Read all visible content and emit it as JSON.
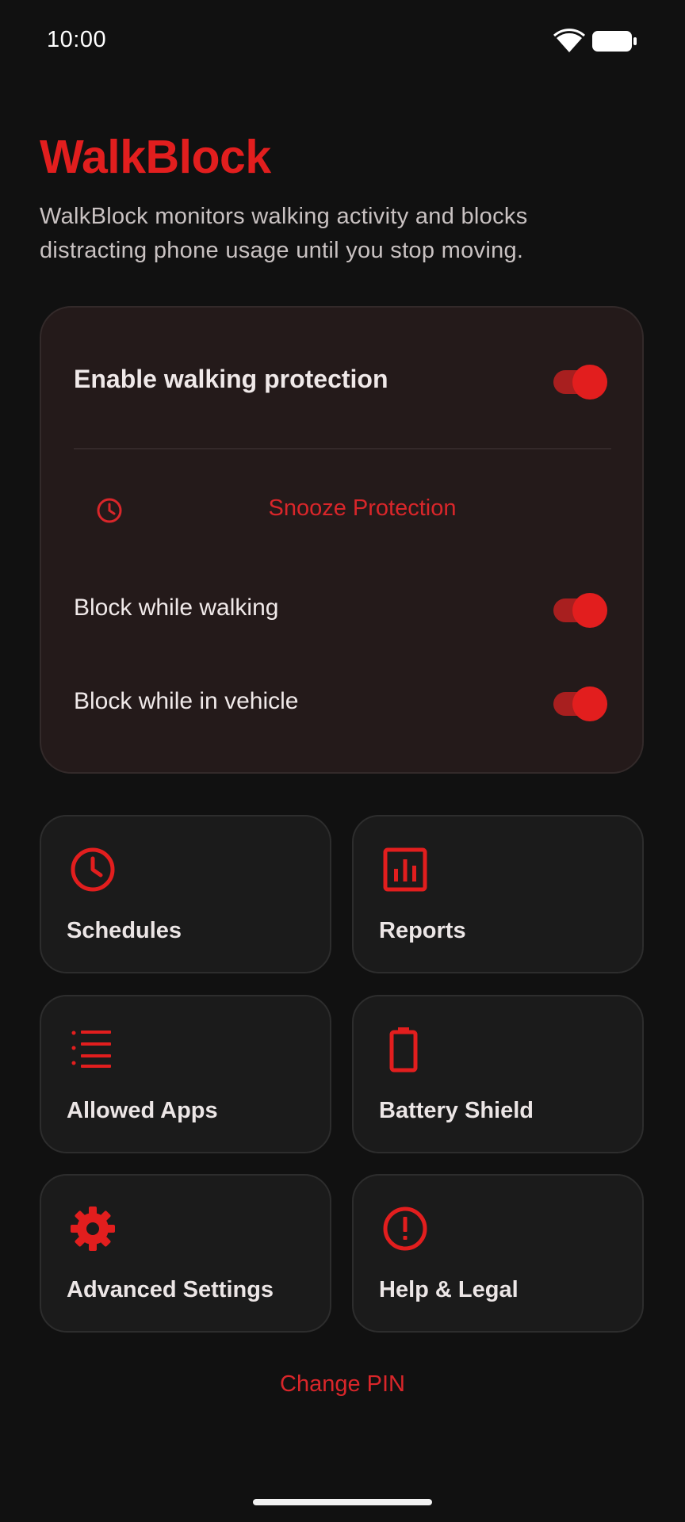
{
  "status_bar": {
    "time": "10:00"
  },
  "header": {
    "title": "WalkBlock",
    "description": "WalkBlock monitors walking activity and blocks distracting phone usage until you stop moving."
  },
  "protection": {
    "enable_label": "Enable walking protection",
    "enable_on": true,
    "snooze_label": "Snooze Protection",
    "walk_label": "Block while walking",
    "walk_on": true,
    "vehicle_label": "Block while in vehicle",
    "vehicle_on": true
  },
  "tiles": [
    {
      "label": "Schedules",
      "icon": "clock-icon"
    },
    {
      "label": "Reports",
      "icon": "bar-chart-icon"
    },
    {
      "label": "Allowed Apps",
      "icon": "list-icon"
    },
    {
      "label": "Battery Shield",
      "icon": "battery-icon"
    },
    {
      "label": "Advanced Settings",
      "icon": "gear-icon"
    },
    {
      "label": "Help & Legal",
      "icon": "alert-circle-icon"
    }
  ],
  "footer": {
    "change_pin_label": "Change PIN"
  },
  "colors": {
    "accent": "#e21e1e",
    "background": "#111111",
    "card": "#241a1a",
    "tile": "#1b1b1b"
  }
}
